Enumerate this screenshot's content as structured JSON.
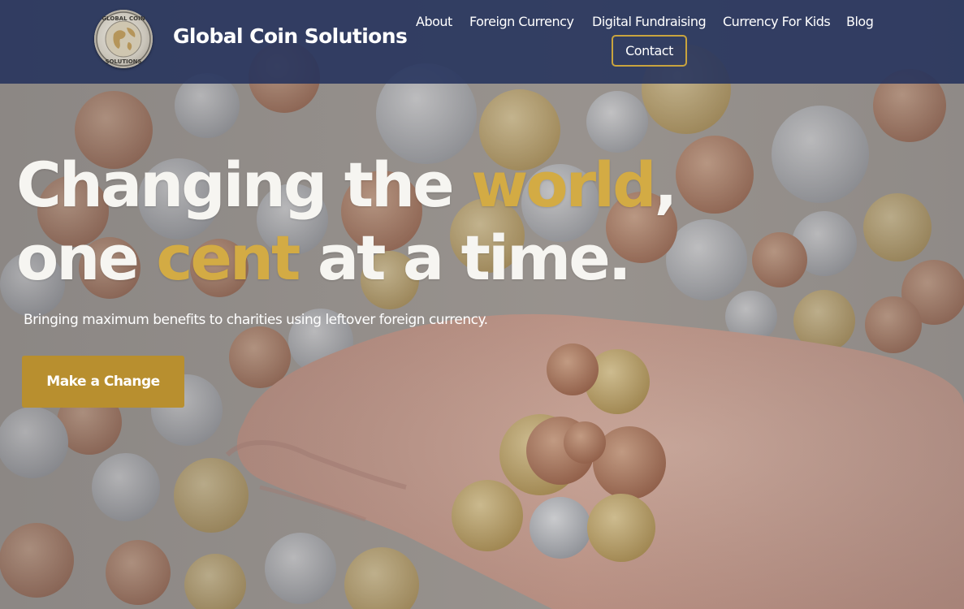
{
  "header": {
    "brand": "Global Coin Solutions",
    "logo_icon": "globe-coin-logo",
    "nav": [
      {
        "label": "About"
      },
      {
        "label": "Foreign Currency"
      },
      {
        "label": "Digital Fundraising"
      },
      {
        "label": "Currency For Kids"
      },
      {
        "label": "Blog"
      }
    ],
    "contact_label": "Contact"
  },
  "hero": {
    "headline": {
      "line1_a": "Changing the ",
      "line1_accent": "world",
      "line1_b": ",",
      "line2_a": "one ",
      "line2_accent": "cent",
      "line2_b": " at a time."
    },
    "subline": "Bringing maximum benefits to charities using leftover foreign currency.",
    "cta_label": "Make a Change",
    "background": "hand-holding-coins-photo"
  },
  "colors": {
    "header_bg": "#24325c",
    "accent_gold": "#d3ab44",
    "cta_bg": "#b88f2f",
    "contact_border": "#c9a43e",
    "text_white": "#ffffff"
  }
}
